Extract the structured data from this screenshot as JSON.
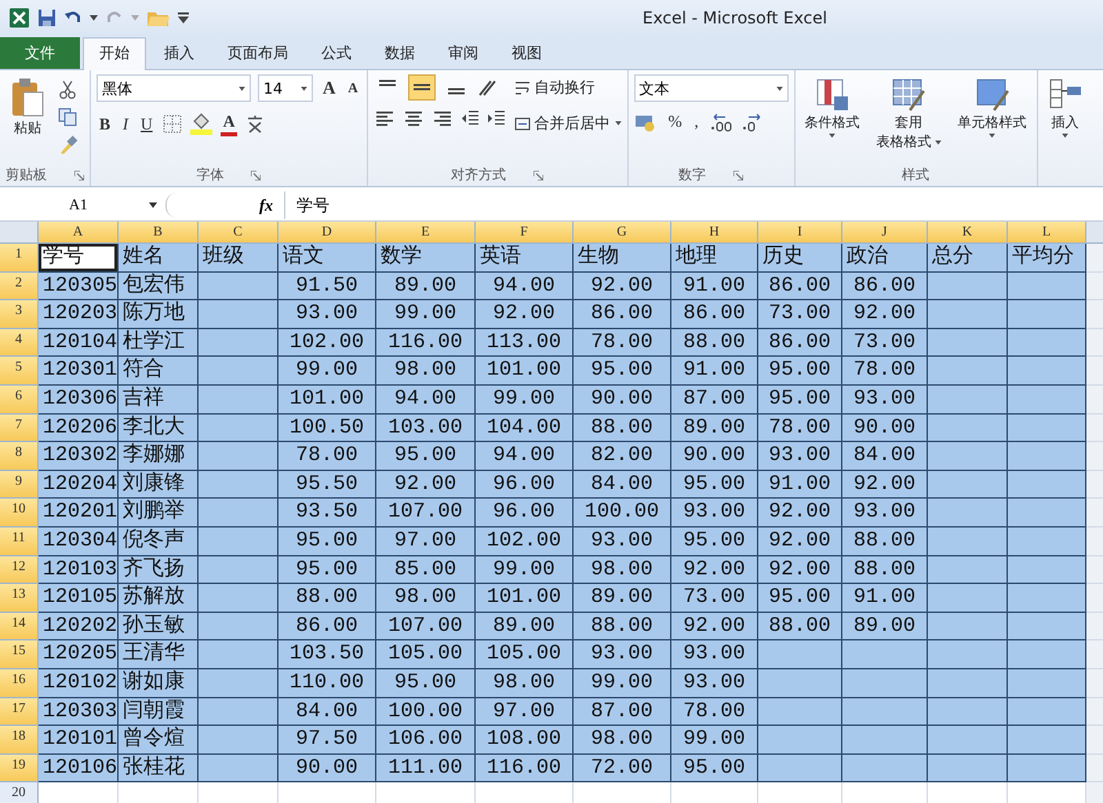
{
  "window": {
    "title": "Excel  -  Microsoft Excel"
  },
  "tabs": [
    {
      "label": "文件",
      "kind": "file",
      "selected": false
    },
    {
      "label": "开始",
      "kind": "tab",
      "selected": true
    },
    {
      "label": "插入",
      "kind": "tab",
      "selected": false
    },
    {
      "label": "页面布局",
      "kind": "tab",
      "selected": false
    },
    {
      "label": "公式",
      "kind": "tab",
      "selected": false
    },
    {
      "label": "数据",
      "kind": "tab",
      "selected": false
    },
    {
      "label": "审阅",
      "kind": "tab",
      "selected": false
    },
    {
      "label": "视图",
      "kind": "tab",
      "selected": false
    }
  ],
  "ribbon": {
    "clipboard": {
      "label": "剪贴板",
      "paste": "粘贴"
    },
    "font": {
      "label": "字体",
      "name": "黑体",
      "size": "14",
      "grow": "A",
      "shrink": "A",
      "bold": "B",
      "italic": "I",
      "underline": "U",
      "font_color": "A"
    },
    "alignment": {
      "label": "对齐方式",
      "vertical": [
        {
          "selected": false
        },
        {
          "selected": true
        },
        {
          "selected": false
        }
      ],
      "wrap": "自动换行",
      "merge": "合并后居中"
    },
    "number": {
      "label": "数字",
      "format": "文本",
      "percent": "%",
      "comma": ","
    },
    "styles": {
      "label": "样式",
      "conditional": "条件格式",
      "table": [
        "套用",
        "表格格式"
      ],
      "cell": "单元格样式"
    },
    "cells": {
      "insert": "插入"
    }
  },
  "formula_bar": {
    "name_box": "A1",
    "fx": "fx",
    "value": "学号"
  },
  "sheet": {
    "columns": [
      {
        "label": "A",
        "selected": true
      },
      {
        "label": "B",
        "selected": true
      },
      {
        "label": "C",
        "selected": true
      },
      {
        "label": "D",
        "selected": true
      },
      {
        "label": "E",
        "selected": true
      },
      {
        "label": "F",
        "selected": true
      },
      {
        "label": "G",
        "selected": true
      },
      {
        "label": "H",
        "selected": true
      },
      {
        "label": "I",
        "selected": true
      },
      {
        "label": "J",
        "selected": true
      },
      {
        "label": "K",
        "selected": true
      },
      {
        "label": "L",
        "selected": true
      }
    ],
    "rows": [
      {
        "number": "1",
        "selected": true,
        "first_cell_active": true,
        "cells": [
          "学号",
          "姓名",
          "班级",
          "语文",
          "数学",
          "英语",
          "生物",
          "地理",
          "历史",
          "政治",
          "总分",
          "平均分"
        ]
      },
      {
        "number": "2",
        "selected": true,
        "first_cell_active": false,
        "cells": [
          "120305",
          "包宏伟",
          null,
          "91.50",
          "89.00",
          "94.00",
          "92.00",
          "91.00",
          "86.00",
          "86.00",
          null,
          null
        ]
      },
      {
        "number": "3",
        "selected": true,
        "first_cell_active": false,
        "cells": [
          "120203",
          "陈万地",
          null,
          "93.00",
          "99.00",
          "92.00",
          "86.00",
          "86.00",
          "73.00",
          "92.00",
          null,
          null
        ]
      },
      {
        "number": "4",
        "selected": true,
        "first_cell_active": false,
        "cells": [
          "120104",
          "杜学江",
          null,
          "102.00",
          "116.00",
          "113.00",
          "78.00",
          "88.00",
          "86.00",
          "73.00",
          null,
          null
        ]
      },
      {
        "number": "5",
        "selected": true,
        "first_cell_active": false,
        "cells": [
          "120301",
          "符合",
          null,
          "99.00",
          "98.00",
          "101.00",
          "95.00",
          "91.00",
          "95.00",
          "78.00",
          null,
          null
        ]
      },
      {
        "number": "6",
        "selected": true,
        "first_cell_active": false,
        "cells": [
          "120306",
          "吉祥",
          null,
          "101.00",
          "94.00",
          "99.00",
          "90.00",
          "87.00",
          "95.00",
          "93.00",
          null,
          null
        ]
      },
      {
        "number": "7",
        "selected": true,
        "first_cell_active": false,
        "cells": [
          "120206",
          "李北大",
          null,
          "100.50",
          "103.00",
          "104.00",
          "88.00",
          "89.00",
          "78.00",
          "90.00",
          null,
          null
        ]
      },
      {
        "number": "8",
        "selected": true,
        "first_cell_active": false,
        "cells": [
          "120302",
          "李娜娜",
          null,
          "78.00",
          "95.00",
          "94.00",
          "82.00",
          "90.00",
          "93.00",
          "84.00",
          null,
          null
        ]
      },
      {
        "number": "9",
        "selected": true,
        "first_cell_active": false,
        "cells": [
          "120204",
          "刘康锋",
          null,
          "95.50",
          "92.00",
          "96.00",
          "84.00",
          "95.00",
          "91.00",
          "92.00",
          null,
          null
        ]
      },
      {
        "number": "10",
        "selected": true,
        "first_cell_active": false,
        "cells": [
          "120201",
          "刘鹏举",
          null,
          "93.50",
          "107.00",
          "96.00",
          "100.00",
          "93.00",
          "92.00",
          "93.00",
          null,
          null
        ]
      },
      {
        "number": "11",
        "selected": true,
        "first_cell_active": false,
        "cells": [
          "120304",
          "倪冬声",
          null,
          "95.00",
          "97.00",
          "102.00",
          "93.00",
          "95.00",
          "92.00",
          "88.00",
          null,
          null
        ]
      },
      {
        "number": "12",
        "selected": true,
        "first_cell_active": false,
        "cells": [
          "120103",
          "齐飞扬",
          null,
          "95.00",
          "85.00",
          "99.00",
          "98.00",
          "92.00",
          "92.00",
          "88.00",
          null,
          null
        ]
      },
      {
        "number": "13",
        "selected": true,
        "first_cell_active": false,
        "cells": [
          "120105",
          "苏解放",
          null,
          "88.00",
          "98.00",
          "101.00",
          "89.00",
          "73.00",
          "95.00",
          "91.00",
          null,
          null
        ]
      },
      {
        "number": "14",
        "selected": true,
        "first_cell_active": false,
        "cells": [
          "120202",
          "孙玉敏",
          null,
          "86.00",
          "107.00",
          "89.00",
          "88.00",
          "92.00",
          "88.00",
          "89.00",
          null,
          null
        ]
      },
      {
        "number": "15",
        "selected": true,
        "first_cell_active": false,
        "cells": [
          "120205",
          "王清华",
          null,
          "103.50",
          "105.00",
          "105.00",
          "93.00",
          "93.00",
          null,
          null,
          null,
          null
        ]
      },
      {
        "number": "16",
        "selected": true,
        "first_cell_active": false,
        "cells": [
          "120102",
          "谢如康",
          null,
          "110.00",
          "95.00",
          "98.00",
          "99.00",
          "93.00",
          null,
          null,
          null,
          null
        ]
      },
      {
        "number": "17",
        "selected": true,
        "first_cell_active": false,
        "cells": [
          "120303",
          "闫朝霞",
          null,
          "84.00",
          "100.00",
          "97.00",
          "87.00",
          "78.00",
          null,
          null,
          null,
          null
        ]
      },
      {
        "number": "18",
        "selected": true,
        "first_cell_active": false,
        "cells": [
          "120101",
          "曾令煊",
          null,
          "97.50",
          "106.00",
          "108.00",
          "98.00",
          "99.00",
          null,
          null,
          null,
          null
        ]
      },
      {
        "number": "19",
        "selected": true,
        "first_cell_active": false,
        "cells": [
          "120106",
          "张桂花",
          null,
          "90.00",
          "111.00",
          "116.00",
          "72.00",
          "95.00",
          null,
          null,
          null,
          null
        ]
      },
      {
        "number": "20",
        "selected": false,
        "first_cell_active": false,
        "cells": [
          null,
          null,
          null,
          null,
          null,
          null,
          null,
          null,
          null,
          null,
          null,
          null
        ]
      }
    ]
  }
}
